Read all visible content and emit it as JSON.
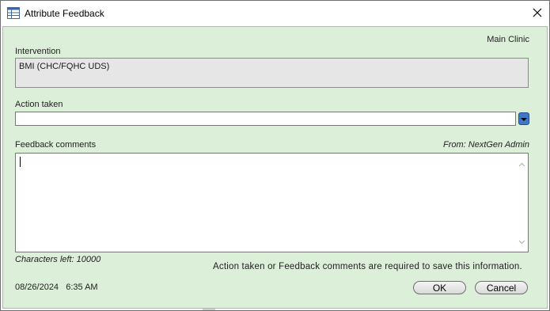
{
  "window": {
    "title": "Attribute Feedback",
    "icon": "table-icon",
    "close_icon": "close-icon"
  },
  "header": {
    "clinic": "Main Clinic"
  },
  "intervention": {
    "label": "Intervention",
    "value": "BMI (CHC/FQHC UDS)"
  },
  "action_taken": {
    "label": "Action taken",
    "selected": "",
    "dropdown_icon": "dropdown-arrow-icon"
  },
  "feedback": {
    "label": "Feedback comments",
    "from": "From: NextGen Admin",
    "value": "",
    "characters_left": "Characters left: 10000"
  },
  "footer": {
    "required_note": "Action taken or Feedback comments are required to save this information.",
    "datetime": "08/26/2024   6:35 AM",
    "ok_label": "OK",
    "cancel_label": "Cancel"
  },
  "colors": {
    "background": "#dcefd9",
    "accent": "#3f79c5"
  }
}
